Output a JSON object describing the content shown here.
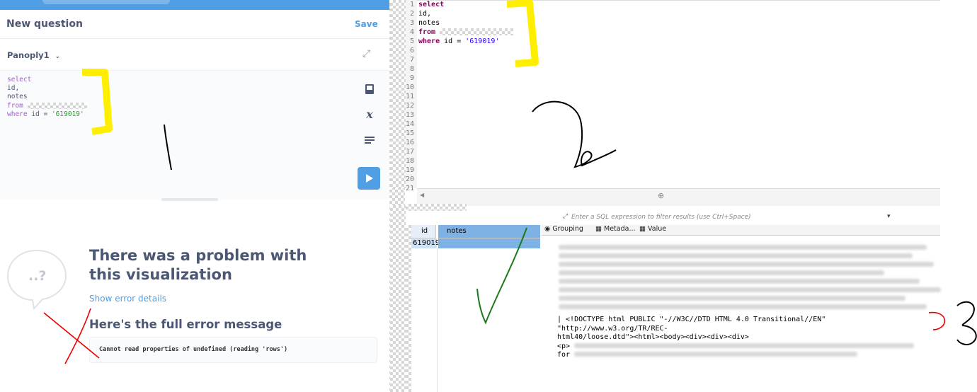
{
  "left_app": {
    "title": "New question",
    "save_label": "Save",
    "database": "Panoply1",
    "sql_lines": [
      "select",
      "id,",
      "notes",
      "from",
      "where id = '619019'"
    ],
    "sql_keywords": {
      "select": "select",
      "from": "from",
      "where": "where"
    },
    "sql_id_line": "id,",
    "sql_notes_line": "notes",
    "sql_where_rest": " id = ",
    "sql_where_value": "'619019'",
    "error_title": "There was a problem with this visualization",
    "show_error_details": "Show error details",
    "full_error_title": "Here's the full error message",
    "error_message": "Cannot read properties of undefined (reading 'rows')",
    "bubble_glyph": "..?",
    "accent": "#509ee3",
    "icons": [
      "collapse-icon",
      "book-icon",
      "variable-icon",
      "snippet-icon",
      "run-icon"
    ]
  },
  "right_ide": {
    "line_numbers": [
      "1",
      "2",
      "3",
      "4",
      "5",
      "6",
      "7",
      "8",
      "9",
      "10",
      "11",
      "12",
      "13",
      "14",
      "15",
      "16",
      "17",
      "18",
      "19",
      "20",
      "21"
    ],
    "code": {
      "select": "select",
      "id": "id,",
      "notes": "notes",
      "from": "from",
      "where_kw": "where",
      "where_rest": " id = ",
      "where_value": "'619019'"
    },
    "filter_placeholder": "Enter a SQL expression to filter results (use Ctrl+Space)",
    "columns": [
      "id",
      "notes"
    ],
    "rows": [
      {
        "id": "619019",
        "notes": ""
      }
    ],
    "panel_tabs": [
      "Grouping",
      "Metada...",
      "Value"
    ],
    "value_text_1": "| <!DOCTYPE html PUBLIC \"-//W3C//DTD HTML 4.0 Transitional//EN\" \"http://www.w3.org/TR/REC-",
    "value_text_2": "html40/loose.dtd\"><html><body><div><div><div>",
    "value_text_3": "<p>",
    "value_text_4": "for"
  },
  "annotations": {
    "digit_1": "1",
    "digit_2": "2",
    "digit_3": "3"
  }
}
